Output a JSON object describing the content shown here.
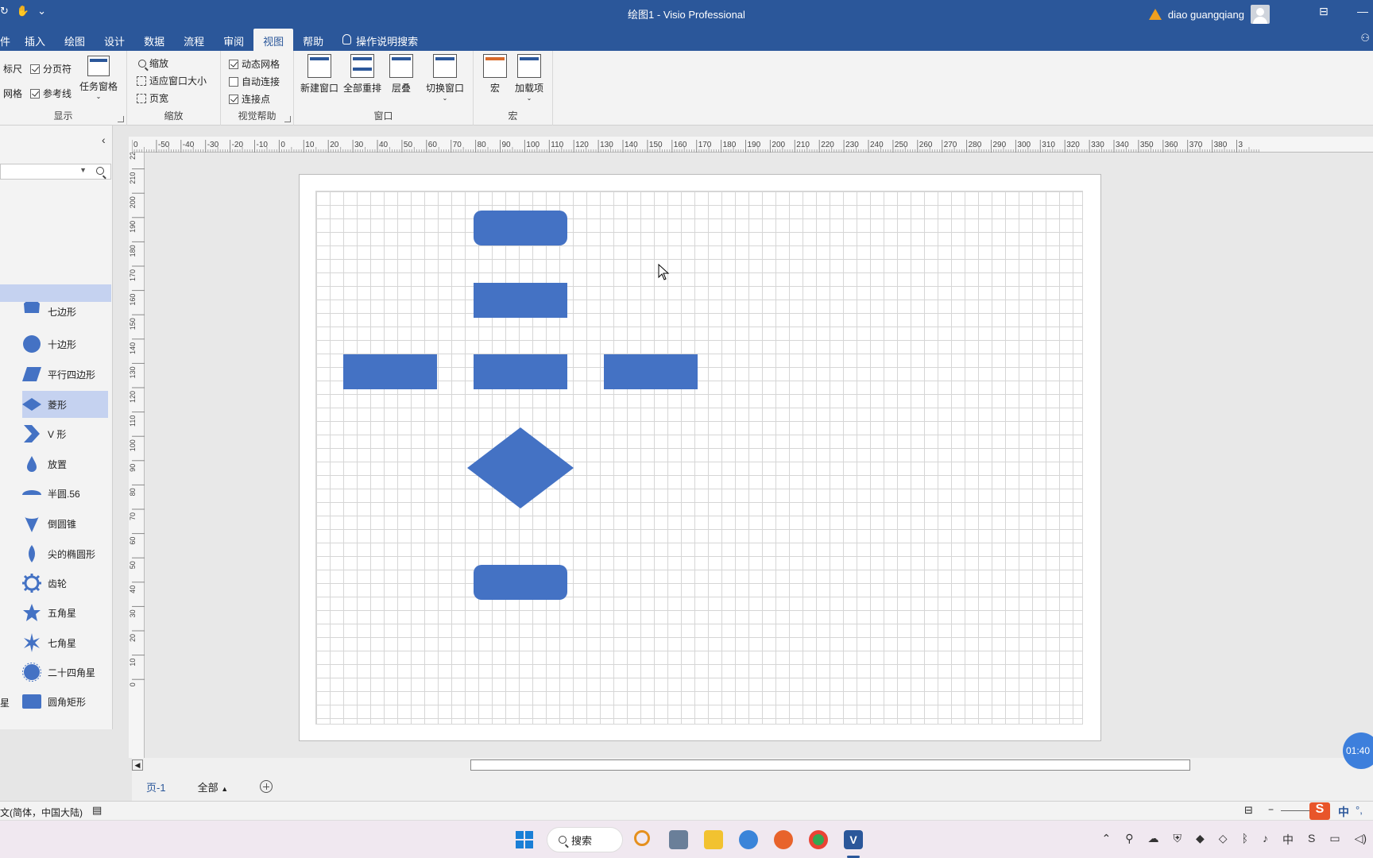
{
  "window": {
    "title": "绘图1  -  Visio Professional",
    "user": "diao guangqiang"
  },
  "tabs": [
    "插入",
    "绘图",
    "设计",
    "数据",
    "流程",
    "审阅",
    "视图",
    "帮助"
  ],
  "active_tab": "视图",
  "tell_me": "操作说明搜索",
  "ribbon": {
    "show": {
      "label": "显示",
      "ruler": "标尺",
      "page_breaks": "分页符",
      "grid": "网格",
      "guides": "参考线",
      "task_panes": "任务窗格"
    },
    "zoom": {
      "label": "缩放",
      "zoom": "缩放",
      "fit_to_window": "适应窗口大小",
      "page_width": "页宽"
    },
    "visual_aids": {
      "label": "视觉帮助",
      "dynamic_grid": "动态网格",
      "autoconnect": "自动连接",
      "connection_points": "连接点"
    },
    "window": {
      "label": "窗口",
      "new_window": "新建窗口",
      "arrange_all": "全部重排",
      "cascade": "层叠",
      "switch_windows": "切换窗口"
    },
    "macros": {
      "label": "宏",
      "macros": "宏",
      "add_ins": "加载项"
    }
  },
  "shapes": [
    {
      "label": "七边形",
      "icon": "heptagon-icon"
    },
    {
      "label": "十边形",
      "icon": "decagon-icon"
    },
    {
      "label": "平行四边形",
      "icon": "parallelogram-icon"
    },
    {
      "label": "菱形",
      "icon": "diamond-icon"
    },
    {
      "label": "V 形",
      "icon": "chevron-icon"
    },
    {
      "label": "放置",
      "icon": "teardrop-icon"
    },
    {
      "label": "半圆.56",
      "icon": "semicircle-icon"
    },
    {
      "label": "倒圆锥",
      "icon": "inverted-cone-icon"
    },
    {
      "label": "尖的椭圆形",
      "icon": "pointed-ellipse-icon"
    },
    {
      "label": "齿轮",
      "icon": "gear-icon"
    },
    {
      "label": "五角星",
      "icon": "five-point-star-icon"
    },
    {
      "label": "七角星",
      "icon": "seven-point-star-icon"
    },
    {
      "label": "二十四角星",
      "icon": "twenty-four-point-star-icon"
    },
    {
      "label": "圆角矩形",
      "icon": "rounded-rectangle-icon"
    }
  ],
  "shapes_extra_left": "星",
  "ruler_top_labels": [
    "0",
    "-50",
    "-40",
    "-30",
    "-20",
    "-10",
    "0",
    "10",
    "20",
    "30",
    "40",
    "50",
    "60",
    "70",
    "80",
    "90",
    "100",
    "110",
    "120",
    "130",
    "140",
    "150",
    "160",
    "170",
    "180",
    "190",
    "200",
    "210",
    "220",
    "230",
    "240",
    "250",
    "260",
    "270",
    "280",
    "290",
    "300",
    "310",
    "320",
    "330",
    "340",
    "350",
    "360",
    "370",
    "380",
    "3"
  ],
  "ruler_left_labels": [
    "220",
    "210",
    "200",
    "190",
    "180",
    "170",
    "160",
    "150",
    "140",
    "130",
    "120",
    "110",
    "100",
    "90",
    "80",
    "70",
    "60",
    "50",
    "40",
    "30",
    "20",
    "10",
    "0"
  ],
  "page_tabs": {
    "page1": "页-1",
    "all": "全部"
  },
  "status": {
    "language": "文(简体，中国大陆)"
  },
  "timer": "01:40",
  "taskbar": {
    "search": "搜索",
    "ime": "中"
  },
  "colors": {
    "accent": "#2b579a",
    "shape_fill": "#4472c4",
    "selection": "#c5d2f0"
  }
}
